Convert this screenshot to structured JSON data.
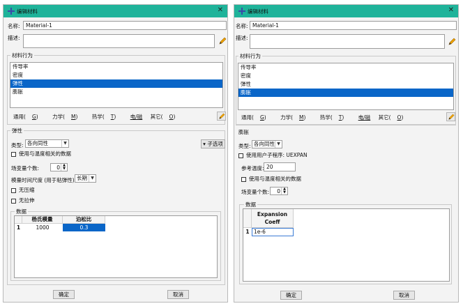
{
  "left": {
    "title": "编辑材料",
    "name_label": "名称:",
    "name_value": "Material-1",
    "desc_label": "描述:",
    "behavior_group_title": "材料行为",
    "behaviors": [
      "传导率",
      "密度",
      "弹性",
      "膨胀"
    ],
    "selected_behavior": "弹性",
    "menu": {
      "general_prefix": "通用(",
      "general_key": "G",
      "mech_prefix": "力学(",
      "mech_key": "M",
      "thermal_prefix": "热学(",
      "thermal_key": "T",
      "elec_prefix": "电/",
      "elec_key": "磁",
      "other_prefix": "其它(",
      "other_key": "O",
      "close": ")"
    },
    "section_title": "弹性",
    "type_label": "类型:",
    "type_value": "各向同性",
    "suboptions_label": "▾ 子选项",
    "cb_temp_dependent": "使用与温度相关的数据",
    "field_vars_label": "场变量个数:",
    "field_vars_value": "0",
    "moduli_label": "模量时间尺度 (用于粘弹性):",
    "moduli_value": "长期",
    "cb_no_compression": "无压缩",
    "cb_no_tension": "无拉伸",
    "data_group_title": "数据",
    "table": {
      "headers": [
        "杨氏模量",
        "泊松比"
      ],
      "row_index": "1",
      "row": [
        "1000",
        "0.3"
      ]
    },
    "ok": "确定",
    "cancel": "取消"
  },
  "right": {
    "title": "编辑材料",
    "name_label": "名称:",
    "name_value": "Material-1",
    "desc_label": "描述:",
    "behavior_group_title": "材料行为",
    "behaviors": [
      "传导率",
      "密度",
      "弹性",
      "膨胀"
    ],
    "selected_behavior": "膨胀",
    "section_title": "膨胀",
    "type_label": "类型:",
    "type_value": "各向同性",
    "cb_user_sub": "使用用户子程序: UEXPAN",
    "ref_temp_label": "参考温度:",
    "ref_temp_value": "20",
    "cb_temp_dependent": "使用与温度相关的数据",
    "field_vars_label": "场变量个数:",
    "field_vars_value": "0",
    "data_group_title": "数据",
    "table": {
      "header_line1": "Expansion",
      "header_line2": "Coeff",
      "row_index": "1",
      "row": [
        "1e-6"
      ]
    },
    "ok": "确定",
    "cancel": "取消"
  },
  "colors": {
    "titlebar": "#1fb39a",
    "selection": "#0a66c8"
  },
  "icons": [
    "window-app-icon",
    "close-icon",
    "pencil-edit-icon",
    "dropdown-arrow-icon",
    "spin-arrows-icon"
  ]
}
